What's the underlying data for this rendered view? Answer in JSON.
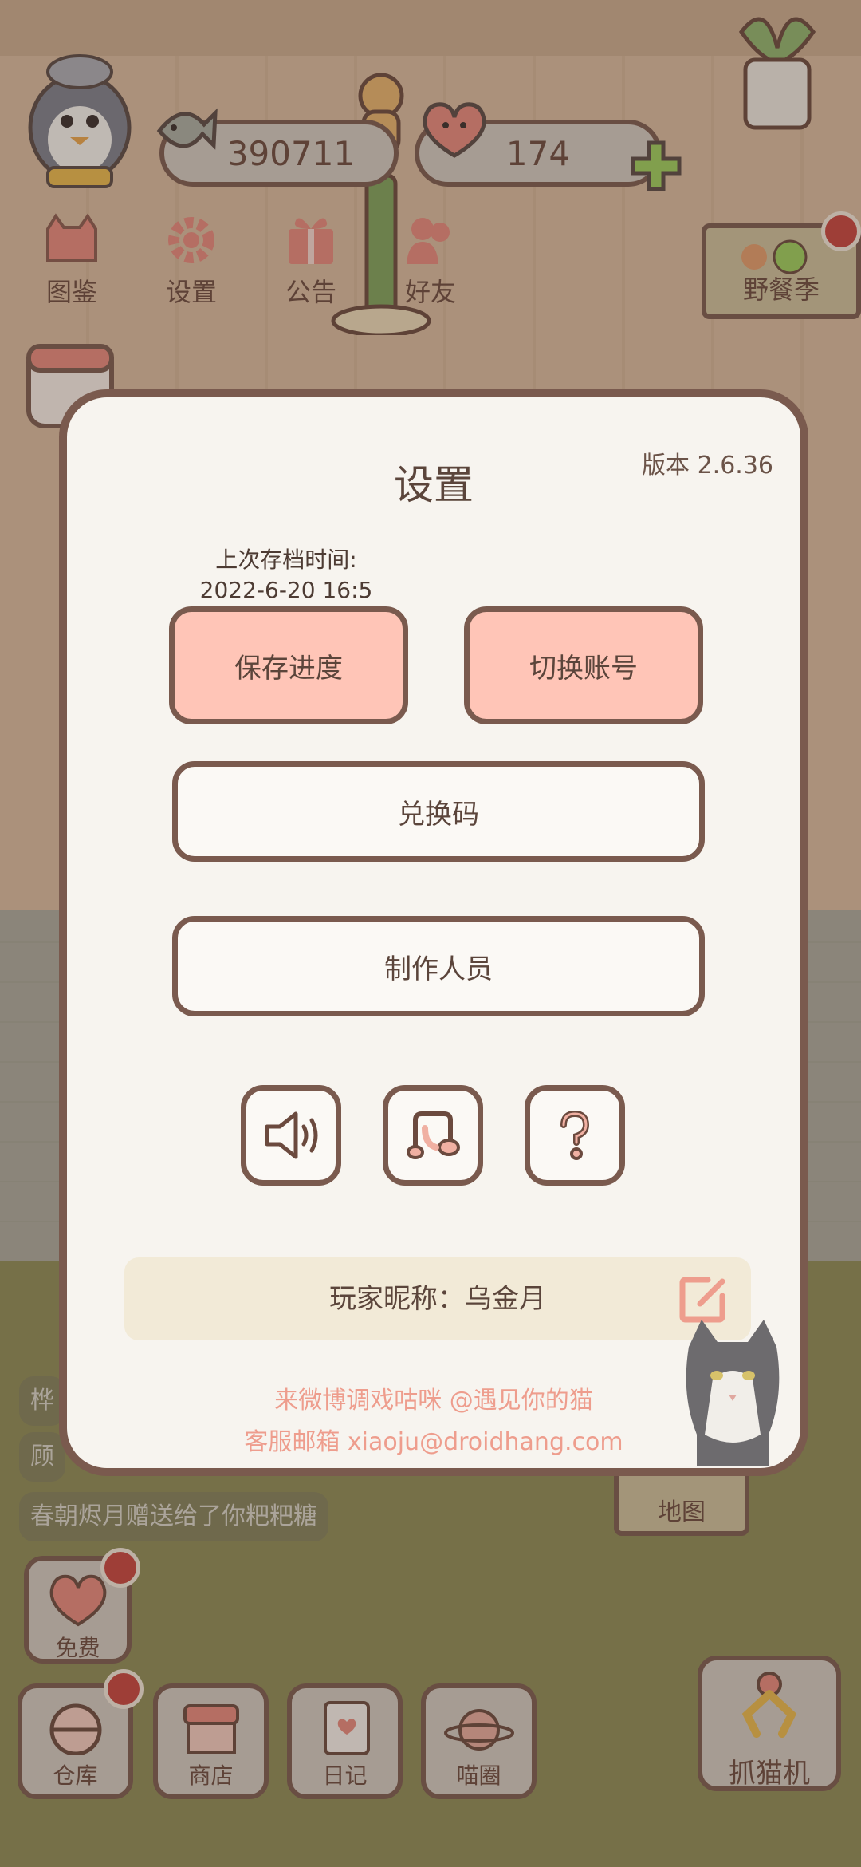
{
  "hud": {
    "fish_count": "390711",
    "heart_count": "174",
    "buttons": [
      {
        "label": "图鉴",
        "icon": "cat-book-icon"
      },
      {
        "label": "设置",
        "icon": "gear-icon"
      },
      {
        "label": "公告",
        "icon": "gift-icon"
      },
      {
        "label": "好友",
        "icon": "friends-icon"
      }
    ],
    "event_label": "野餐季"
  },
  "scene": {
    "chat_messages": [
      "桦",
      "顾",
      "春朝烬月赠送给了你粑粑糖"
    ],
    "map_label": "地图"
  },
  "bottom_bar": {
    "free_label": "免费",
    "warehouse_label": "仓库",
    "shop_label": "商店",
    "diary_label": "日记",
    "circle_label": "喵圈",
    "claw_label": "抓猫机"
  },
  "settings": {
    "title": "设置",
    "version": "版本 2.6.36",
    "save_time_label": "上次存档时间:",
    "save_time_value": "2022-6-20 16:5",
    "save_button": "保存进度",
    "switch_account_button": "切换账号",
    "redeem_button": "兑换码",
    "credits_button": "制作人员",
    "icon_buttons": [
      "sound-icon",
      "music-icon",
      "help-icon"
    ],
    "nickname_text": "玩家昵称：乌金月",
    "footer_weibo": "来微博调戏咕咪 @遇见你的猫",
    "footer_email": "客服邮箱 xiaoju@droidhang.com"
  },
  "colors": {
    "border": "#7a5a4e",
    "pink_button": "#ffc5b7",
    "modal_bg": "#f7f4ef",
    "footer_text": "#ee9d8d",
    "nickname_bg": "#f2ead7"
  }
}
